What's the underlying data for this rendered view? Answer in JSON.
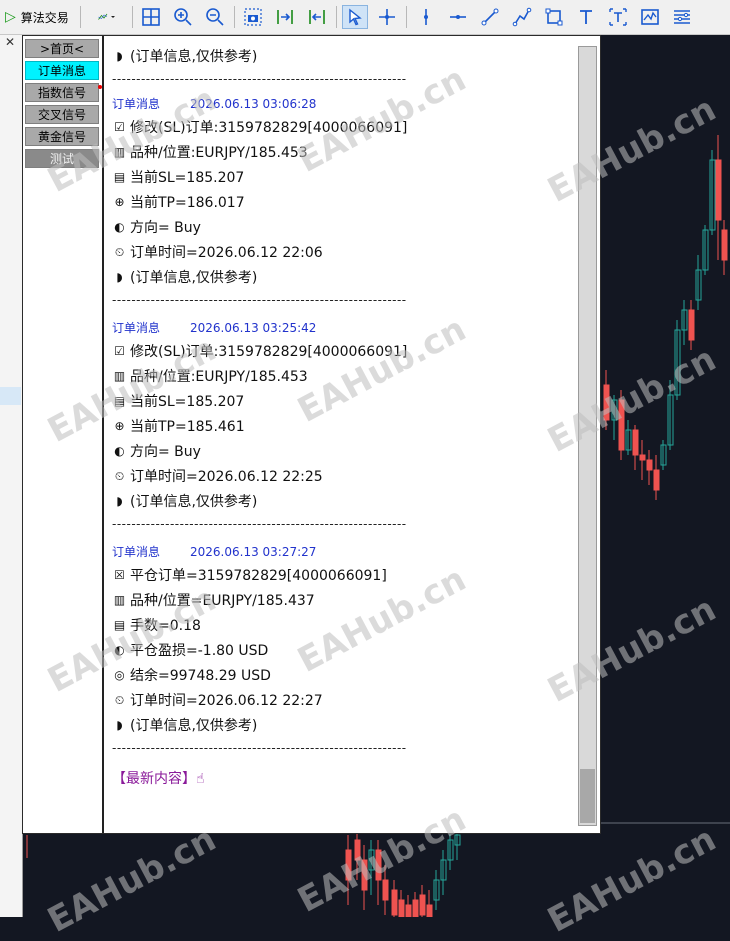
{
  "toolbar": {
    "algo_label": "算法交易"
  },
  "nav": {
    "items": [
      {
        "label": ">首页<",
        "state": "normal"
      },
      {
        "label": "订单消息",
        "state": "active"
      },
      {
        "label": "指数信号",
        "state": "normal"
      },
      {
        "label": "交叉信号",
        "state": "normal"
      },
      {
        "label": "黄金信号",
        "state": "normal"
      },
      {
        "label": "测试",
        "state": "muted"
      }
    ]
  },
  "content": {
    "top_line": "(订单信息,仅供参考)",
    "separator": "-------------------------------------------------------------",
    "messages": [
      {
        "header": "订单消息",
        "time": "2026.06.13 03:06:28",
        "lines": [
          {
            "icon": "checkbox-icon",
            "text": "修改(SL)订单:3159782829[4000066091]"
          },
          {
            "icon": "bar-chart-icon",
            "text": "品种/位置:EURJPY/185.453"
          },
          {
            "icon": "trend-icon",
            "text": "当前SL=185.207"
          },
          {
            "icon": "globe-icon",
            "text": "当前TP=186.017"
          },
          {
            "icon": "direction-icon",
            "text": "方向= Buy"
          },
          {
            "icon": "clock-icon",
            "text": "订单时间=2026.06.12 22:06"
          },
          {
            "icon": "shield-icon",
            "text": "(订单信息,仅供参考)"
          }
        ]
      },
      {
        "header": "订单消息",
        "time": "2026.06.13 03:25:42",
        "lines": [
          {
            "icon": "checkbox-icon",
            "text": "修改(SL)订单:3159782829[4000066091]"
          },
          {
            "icon": "bar-chart-icon",
            "text": "品种/位置:EURJPY/185.453"
          },
          {
            "icon": "trend-icon",
            "text": "当前SL=185.207"
          },
          {
            "icon": "globe-icon",
            "text": "当前TP=185.461"
          },
          {
            "icon": "direction-icon",
            "text": "方向= Buy"
          },
          {
            "icon": "clock-icon",
            "text": "订单时间=2026.06.12 22:25"
          },
          {
            "icon": "shield-icon",
            "text": "(订单信息,仅供参考)"
          }
        ]
      },
      {
        "header": "订单消息",
        "time": "2026.06.13 03:27:27",
        "lines": [
          {
            "icon": "close-box-icon",
            "text": "平仓订单=3159782829[4000066091]"
          },
          {
            "icon": "bar-chart-icon",
            "text": "品种/位置=EURJPY/185.437"
          },
          {
            "icon": "trend-icon",
            "text": "手数=0.18"
          },
          {
            "icon": "direction-icon",
            "text": "平仓盈损=-1.80 USD"
          },
          {
            "icon": "money-icon",
            "text": "结余=99748.29 USD"
          },
          {
            "icon": "clock-icon",
            "text": "订单时间=2026.06.12 22:27"
          },
          {
            "icon": "shield-icon",
            "text": "(订单信息,仅供参考)"
          }
        ]
      }
    ],
    "latest": "【最新内容】☝"
  },
  "watermark": "EAHub.cn",
  "colors": {
    "active_nav": "#00f2ff",
    "header_blue": "#2233cc",
    "latest_purple": "#8a1a9a",
    "bull_candle": "#26a69a",
    "bear_candle": "#ef5350"
  }
}
